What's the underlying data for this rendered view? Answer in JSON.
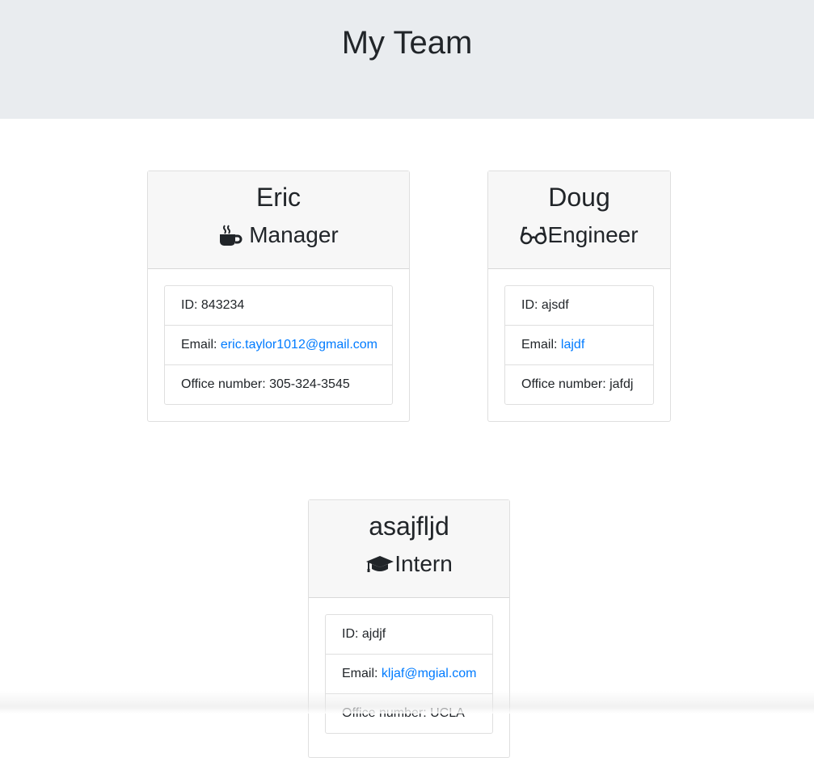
{
  "header": {
    "title": "My Team"
  },
  "cards": [
    {
      "name": "Eric",
      "role": "Manager",
      "icon": "coffee-mug-icon",
      "id_label": "ID: ",
      "id": "843234",
      "email_label": "Email: ",
      "email": "eric.taylor1012@gmail.com",
      "extra_label": "Office number: ",
      "extra": "305-324-3545"
    },
    {
      "name": "Doug",
      "role": "Engineer",
      "icon": "glasses-icon",
      "id_label": "ID: ",
      "id": "ajsdf",
      "email_label": "Email: ",
      "email": "lajdf",
      "extra_label": "Office number: ",
      "extra": "jafdj"
    },
    {
      "name": "asajfljd",
      "role": "Intern",
      "icon": "graduation-cap-icon",
      "id_label": "ID: ",
      "id": "ajdjf",
      "email_label": "Email: ",
      "email": "kljaf@mgial.com",
      "extra_label": "Office number: ",
      "extra": "UCLA"
    }
  ],
  "colors": {
    "header_bg": "#e9ecef",
    "card_header_bg": "#f7f7f7",
    "link": "#007bff",
    "text": "#212529"
  }
}
